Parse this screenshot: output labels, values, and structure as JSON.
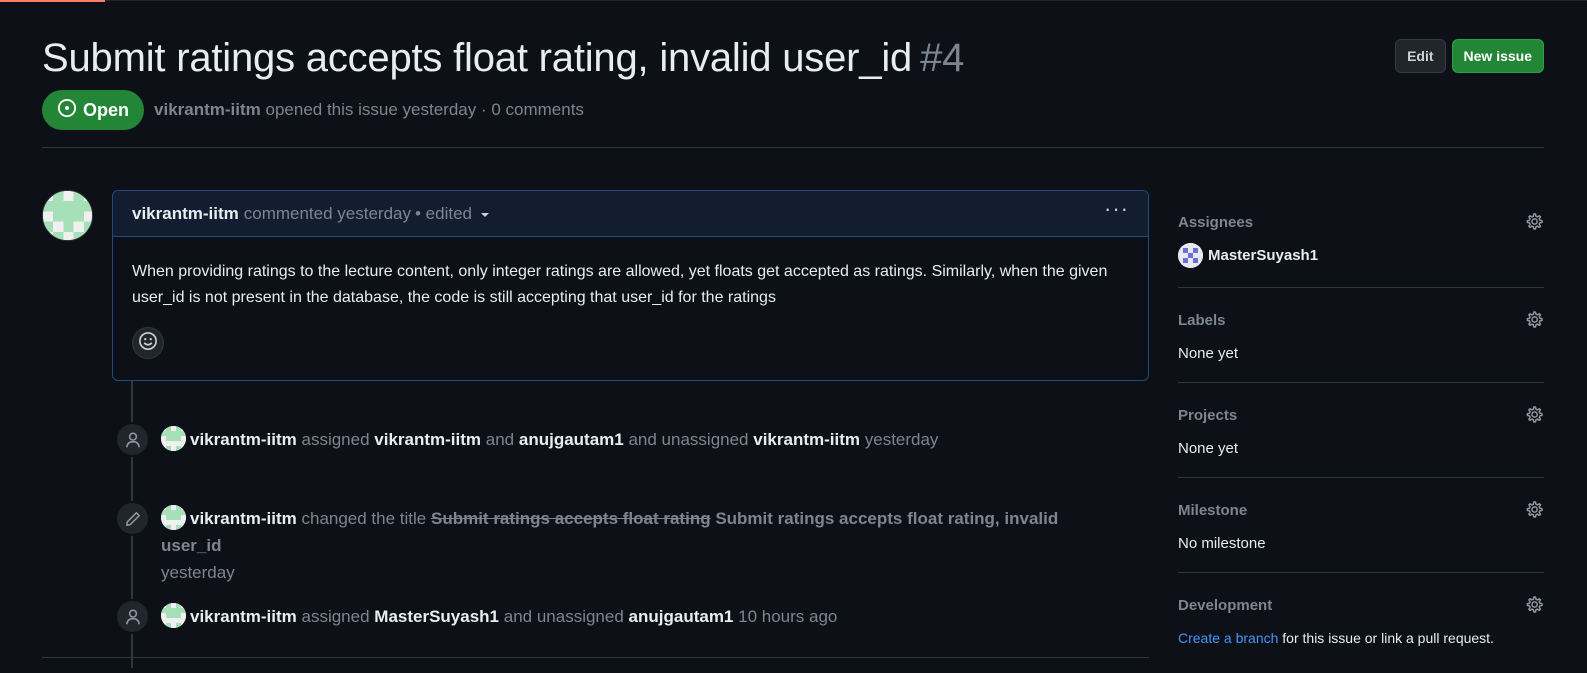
{
  "issue": {
    "title": "Submit ratings accepts float rating, invalid user_id",
    "number": "#4",
    "state": "Open",
    "author": "vikrantm-iitm",
    "meta": "opened this issue yesterday · 0 comments"
  },
  "actions": {
    "edit_label": "Edit",
    "new_issue_label": "New issue"
  },
  "comment": {
    "author": "vikrantm-iitm",
    "meta": "commented yesterday",
    "edited": "• edited",
    "menu": "···",
    "body": "When providing ratings to the lecture content, only integer ratings are allowed, yet floats get accepted as ratings. Similarly, when the given user_id is not present in the database, the code is still accepting that user_id for the ratings"
  },
  "events": [
    {
      "actor": "vikrantm-iitm",
      "w1": "assigned",
      "u1": "vikrantm-iitm",
      "w2": "and",
      "u2": "anujgautam1",
      "w3": "and unassigned",
      "u3": "vikrantm-iitm",
      "time": "yesterday"
    },
    {
      "actor": "vikrantm-iitm",
      "w1": "changed the title",
      "old_title": "Submit ratings accepts float rating",
      "new_title": "Submit ratings accepts float rating, invalid user_id",
      "time": "yesterday"
    },
    {
      "actor": "vikrantm-iitm",
      "w1": "assigned",
      "u1": "MasterSuyash1",
      "w2": "and unassigned",
      "u2": "anujgautam1",
      "time": "10 hours ago"
    }
  ],
  "sidebar": {
    "assignees": {
      "heading": "Assignees",
      "user": "MasterSuyash1"
    },
    "labels": {
      "heading": "Labels",
      "value": "None yet"
    },
    "projects": {
      "heading": "Projects",
      "value": "None yet"
    },
    "milestone": {
      "heading": "Milestone",
      "value": "No milestone"
    },
    "development": {
      "heading": "Development",
      "link": "Create a branch",
      "rest": "for this issue or link a pull request."
    }
  },
  "colors": {
    "background": "#0d1117",
    "open_green": "#238636",
    "link_blue": "#4493f8",
    "muted": "#7d8590"
  }
}
